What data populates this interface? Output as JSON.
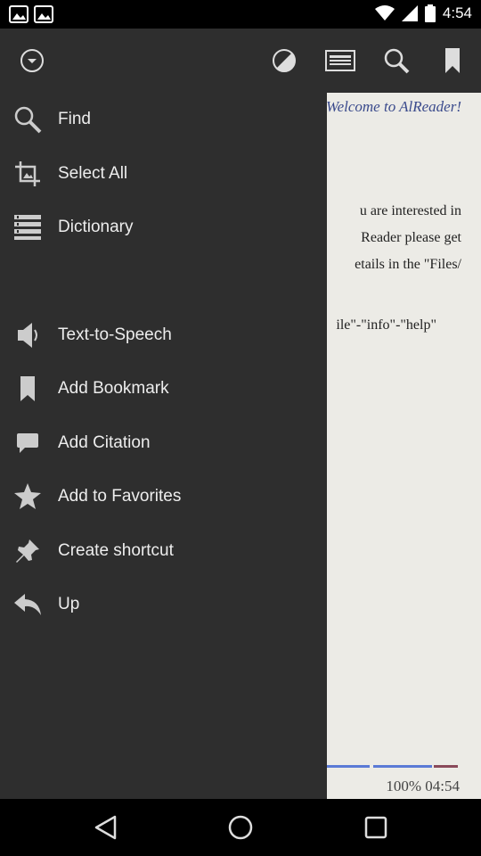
{
  "status_bar": {
    "time": "4:54",
    "icons": [
      "image-icon",
      "image-icon",
      "wifi-icon",
      "signal-icon",
      "battery-icon"
    ]
  },
  "toolbar": {
    "icons": [
      "chevron-down-circle-icon",
      "contrast-icon",
      "article-icon",
      "search-icon",
      "bookmark-icon"
    ]
  },
  "drawer": {
    "items": [
      {
        "label": "Find",
        "icon": "search-icon"
      },
      {
        "label": "Select All",
        "icon": "crop-icon"
      },
      {
        "label": "Dictionary",
        "icon": "list-icon"
      },
      {
        "label": "Text-to-Speech",
        "icon": "speaker-icon"
      },
      {
        "label": "Add Bookmark",
        "icon": "bookmark-icon"
      },
      {
        "label": "Add Citation",
        "icon": "comment-icon"
      },
      {
        "label": "Add to Favorites",
        "icon": "star-icon"
      },
      {
        "label": "Create shortcut",
        "icon": "pin-icon"
      },
      {
        "label": "Up",
        "icon": "reply-icon"
      }
    ]
  },
  "page": {
    "title": "Welcome to AlReader!",
    "lines": [
      "u are interested in",
      "Reader please get",
      "etails in the \"Files/",
      "ile\"-\"info\"-\"help\""
    ],
    "footer": "100% 04:54",
    "accent": "#3a4a8c"
  },
  "nav_bar": {
    "icons": [
      "back-icon",
      "home-icon",
      "recents-icon"
    ]
  }
}
